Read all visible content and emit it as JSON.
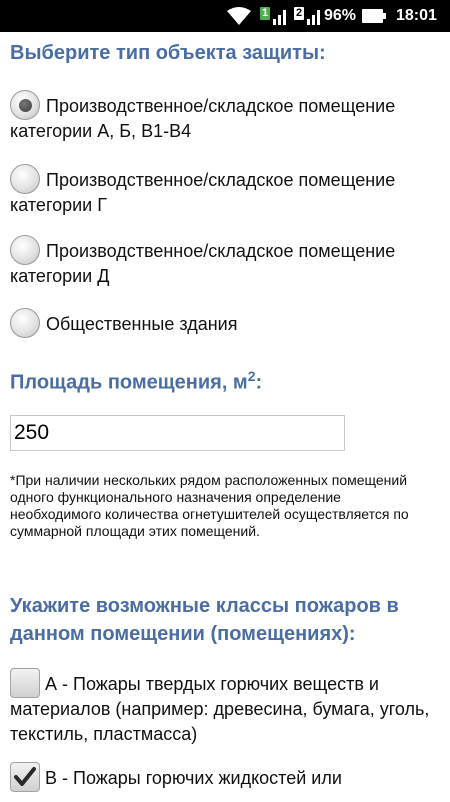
{
  "status_bar": {
    "battery_percent": "96%",
    "time": "18:01",
    "sim1_label": "1",
    "sim2_label": "2",
    "icons": [
      "wifi-icon",
      "signal-icon",
      "signal-icon",
      "battery-icon"
    ]
  },
  "section_object_type": {
    "heading": "Выберите тип объекта защиты:",
    "options": [
      {
        "label": "Производственное/складское помещение категории А, Б, В1-В4",
        "selected": true
      },
      {
        "label": "Производственное/складское помещение категории Г",
        "selected": false
      },
      {
        "label": "Производственное/складское помещение категории Д",
        "selected": false
      },
      {
        "label": "Общественные здания",
        "selected": false
      }
    ]
  },
  "section_area": {
    "heading": "Площадь помещения, м",
    "heading_sup": "2",
    "heading_suffix": ":",
    "value": "250",
    "note": "*При наличии нескольких рядом расположенных помещений одного функционального назначения определение необходимого количества огнетушителей осуществляется по суммарной площади этих помещений."
  },
  "section_fire_classes": {
    "heading": "Укажите возможные классы пожаров в данном помещении (помещениях):",
    "options": [
      {
        "label": "А - Пожары твердых горючих веществ и материалов (например: древесина, бумага, уголь, текстиль, пластмасса)",
        "checked": false
      },
      {
        "label": "В - Пожары горючих жидкостей или",
        "checked": true
      }
    ]
  },
  "colors": {
    "heading": "#4a6da4",
    "status_bar_bg": "#000000",
    "sim_badge": "#4caf50"
  }
}
